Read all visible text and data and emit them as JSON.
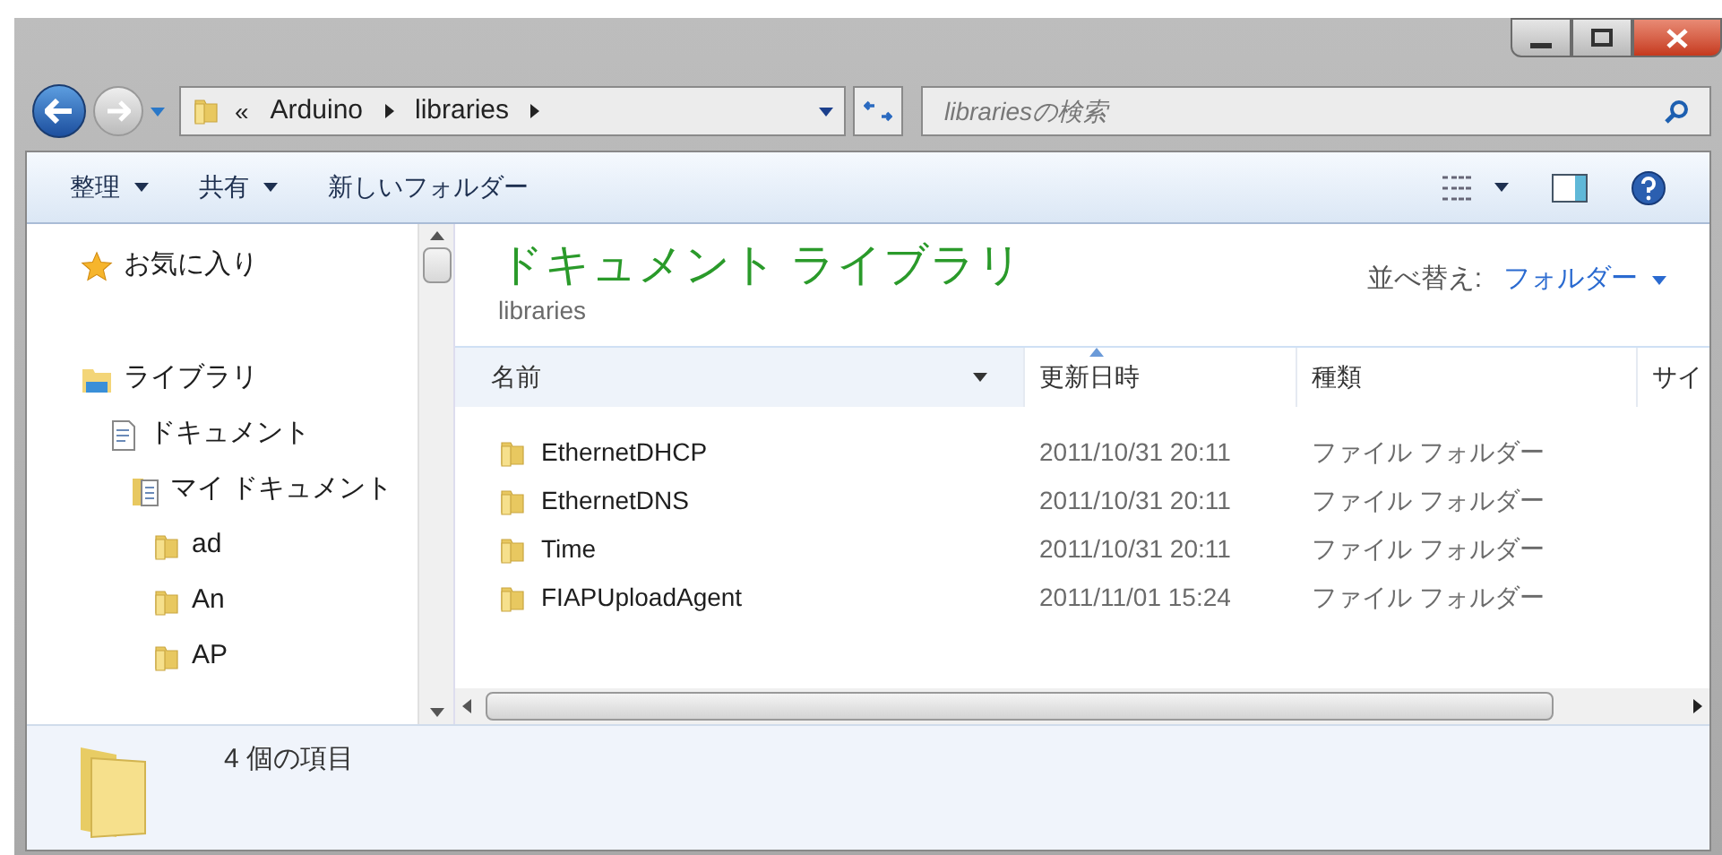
{
  "window": {
    "buttons": [
      {
        "kind": "minimize"
      },
      {
        "kind": "maximize"
      },
      {
        "kind": "close"
      }
    ]
  },
  "address": {
    "overflow": "«",
    "crumbs": [
      "Arduino",
      "libraries"
    ]
  },
  "search": {
    "placeholder": "librariesの検索"
  },
  "toolbar": {
    "items": [
      "整理",
      "共有",
      "新しいフォルダー"
    ],
    "dropdown": [
      true,
      true,
      false
    ]
  },
  "sidebar": {
    "items": [
      {
        "label": "お気に入り",
        "kind": "favorites"
      },
      {
        "label": "ライブラリ",
        "kind": "library",
        "children": [
          {
            "label": "ドキュメント",
            "kind": "document",
            "children": [
              {
                "label": "マイ ドキュメント",
                "kind": "mydocs",
                "children": [
                  {
                    "label": "ad",
                    "kind": "folder"
                  },
                  {
                    "label": "An",
                    "kind": "folder"
                  },
                  {
                    "label": "AP",
                    "kind": "folder"
                  }
                ]
              }
            ]
          }
        ]
      }
    ]
  },
  "library": {
    "title": "ドキュメント ライブラリ",
    "subtitle": "libraries",
    "sort_label": "並べ替え:",
    "sort_value": "フォルダー"
  },
  "table": {
    "columns": [
      {
        "label": "名前",
        "dropdown": true,
        "sorted": false
      },
      {
        "label": "更新日時",
        "dropdown": false,
        "sorted": true
      },
      {
        "label": "種類",
        "dropdown": false,
        "sorted": false
      },
      {
        "label": "サイ",
        "dropdown": false,
        "sorted": false
      }
    ],
    "rows": [
      [
        "EthernetDHCP",
        "2011/10/31 20:11",
        "ファイル フォルダー"
      ],
      [
        "EthernetDNS",
        "2011/10/31 20:11",
        "ファイル フォルダー"
      ],
      [
        "Time",
        "2011/10/31 20:11",
        "ファイル フォルダー"
      ],
      [
        "FIAPUploadAgent",
        "2011/11/01 15:24",
        "ファイル フォルダー"
      ]
    ]
  },
  "status_bar": {
    "count": "4 個の項目"
  }
}
